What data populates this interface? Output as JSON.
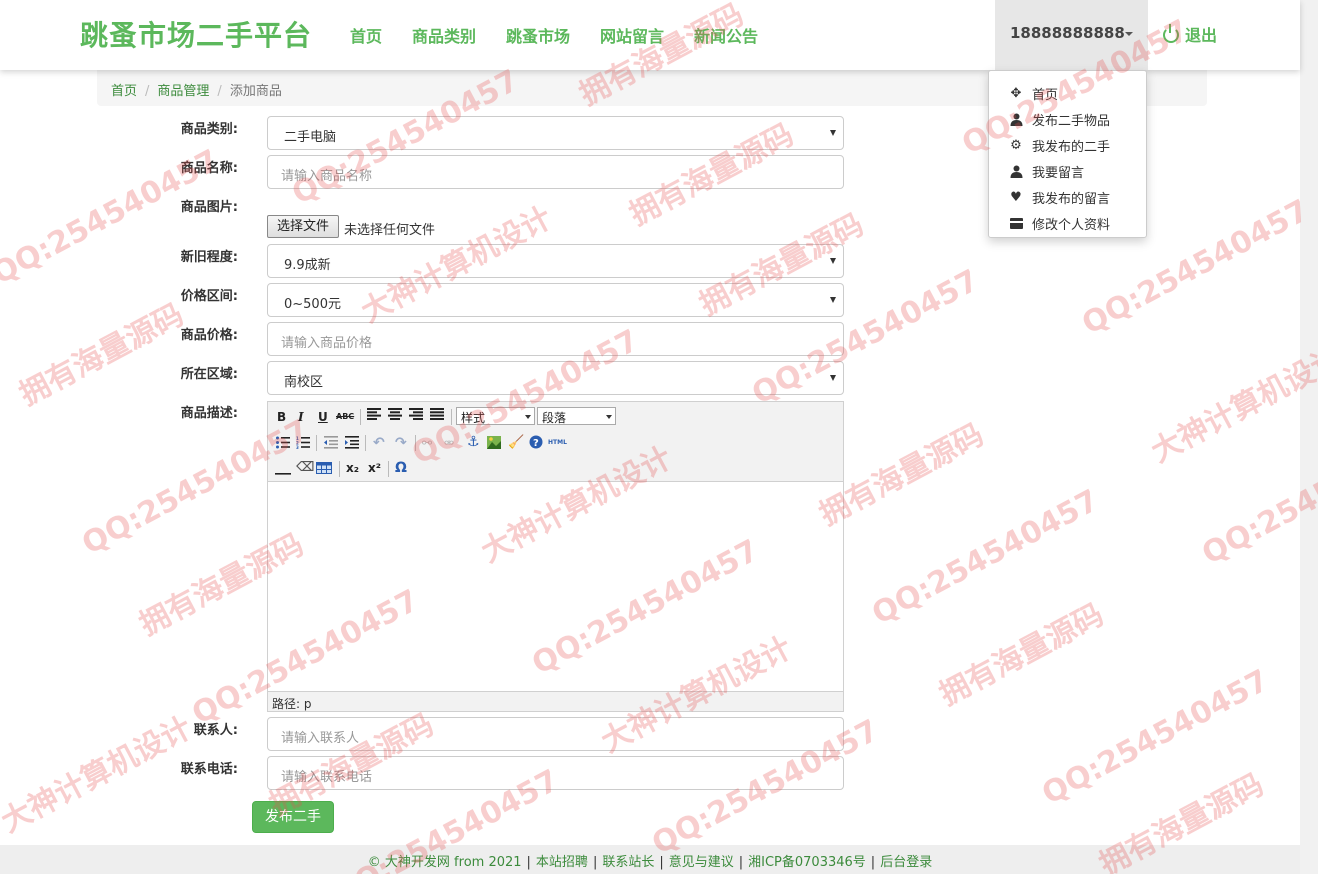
{
  "header": {
    "brand": "跳蚤市场二手平台",
    "nav": [
      "首页",
      "商品类别",
      "跳蚤市场",
      "网站留言",
      "新闻公告"
    ],
    "user": "18888888888",
    "logout": "退出"
  },
  "dropdown": {
    "items": [
      {
        "label": "首页",
        "icon": "move-icon"
      },
      {
        "label": "发布二手物品",
        "icon": "user-icon"
      },
      {
        "label": "我发布的二手",
        "icon": "gear-icon"
      },
      {
        "label": "我要留言",
        "icon": "user-icon"
      },
      {
        "label": "我发布的留言",
        "icon": "heart-icon"
      },
      {
        "label": "修改个人资料",
        "icon": "card-icon"
      }
    ]
  },
  "breadcrumb": [
    "首页",
    "商品管理",
    "添加商品"
  ],
  "form": {
    "category_label": "商品类别:",
    "category_value": "二手电脑",
    "name_label": "商品名称:",
    "name_placeholder": "请输入商品名称",
    "image_label": "商品图片:",
    "file_button": "选择文件",
    "file_status": "未选择任何文件",
    "condition_label": "新旧程度:",
    "condition_value": "9.9成新",
    "price_range_label": "价格区间:",
    "price_range_value": "0~500元",
    "price_label": "商品价格:",
    "price_placeholder": "请输入商品价格",
    "area_label": "所在区域:",
    "area_value": "南校区",
    "desc_label": "商品描述:",
    "contact_label": "联系人:",
    "contact_placeholder": "请输入联系人",
    "phone_label": "联系电话:",
    "phone_placeholder": "请输入联系电话",
    "submit": "发布二手"
  },
  "editor": {
    "style_select": "样式",
    "paragraph_select": "段落",
    "status_path": "路径: p",
    "bold": "B",
    "italic": "I",
    "underline": "U",
    "strike": "ABC",
    "html": "HTML",
    "sub": "x₂",
    "sup": "x²",
    "omega": "Ω"
  },
  "footer": {
    "items": [
      "© 大神开发网 from 2021",
      "本站招聘",
      "联系站长",
      "意见与建议",
      "湘ICP备0703346号",
      "后台登录"
    ]
  },
  "watermark": {
    "qq": "QQ:254540457",
    "a": "拥有海量源码",
    "b": "大神计算机设计"
  }
}
